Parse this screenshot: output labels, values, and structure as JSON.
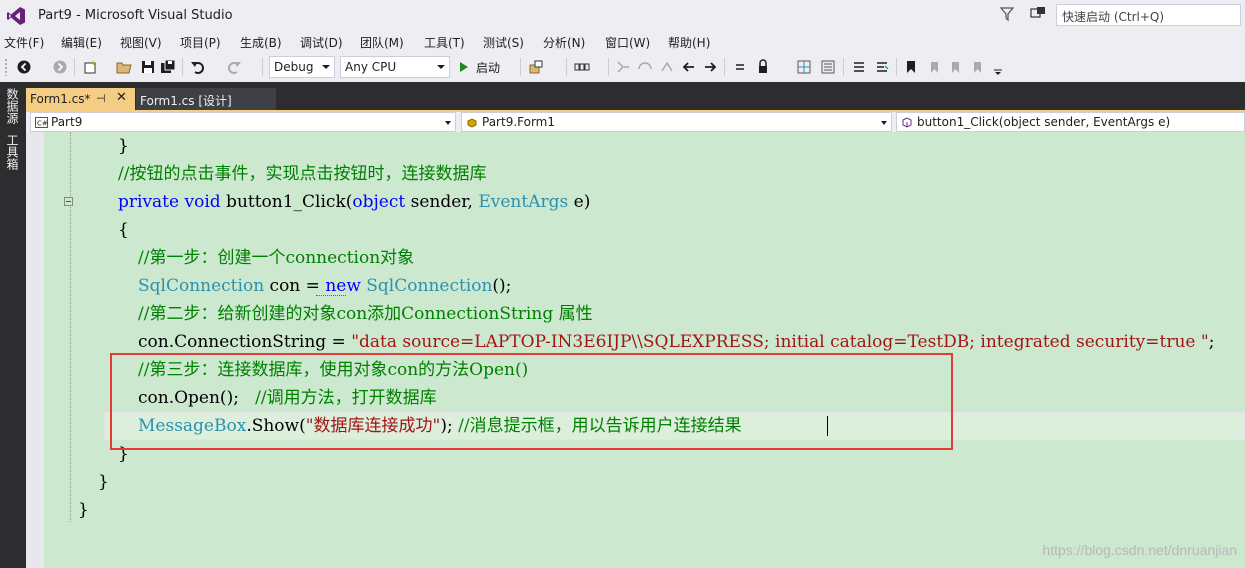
{
  "window": {
    "title": "Part9 - Microsoft Visual Studio",
    "quick_launch_placeholder": "快速启动 (Ctrl+Q)"
  },
  "menu": [
    "文件(F)",
    "编辑(E)",
    "视图(V)",
    "项目(P)",
    "生成(B)",
    "调试(D)",
    "团队(M)",
    "工具(T)",
    "测试(S)",
    "分析(N)",
    "窗口(W)",
    "帮助(H)"
  ],
  "toolbar": {
    "config": "Debug",
    "platform": "Any CPU",
    "start_label": "启动"
  },
  "side_tabs": [
    "数据源",
    "工具箱"
  ],
  "tabs": [
    {
      "label": "Form1.cs*",
      "pin": "⊣",
      "close": "✕"
    },
    {
      "label": "Form1.cs [设计]"
    }
  ],
  "nav": {
    "project": "Part9",
    "class": "Part9.Form1",
    "member": "button1_Click(object sender, EventArgs e)"
  },
  "code": {
    "l1": "}",
    "l2_comment": "//按钮的点击事件，实现点击按钮时，连接数据库",
    "l3_private": "private",
    "l3_void": "void",
    "l3_name": " button1_Click(",
    "l3_object": "object",
    "l3_sender": " sender, ",
    "l3_eventargs": "EventArgs",
    "l3_e": " e)",
    "l4": "{",
    "l5_comment": "//第一步：创建一个connection对象",
    "l6_type": "SqlConnection",
    "l6_var": " con = ",
    "l6_new": "new",
    "l6_space": " ",
    "l6_type2": "SqlConnection",
    "l6_end": "();",
    "l7_comment": "//第二步：给新创建的对象con添加ConnectionString 属性",
    "l8_prefix": "con.ConnectionString = ",
    "l8_string": "\"data source=LAPTOP-IN3E6IJP\\\\SQLEXPRESS; initial catalog=TestDB; integrated security=true \"",
    "l8_end": ";",
    "l9_comment": "//第三步：连接数据库，使用对象con的方法Open()",
    "l10_code": "con.Open();   ",
    "l10_comment": "//调用方法，打开数据库",
    "l11_type": "MessageBox",
    "l11_show": ".Show(",
    "l11_string": "\"数据库连接成功\"",
    "l11_end": "); ",
    "l11_comment": "//消息提示框，用以告诉用户连接结果",
    "l12": "}",
    "l13": "}",
    "l14": "}"
  },
  "watermark": "https://blog.csdn.net/dnruanjian"
}
